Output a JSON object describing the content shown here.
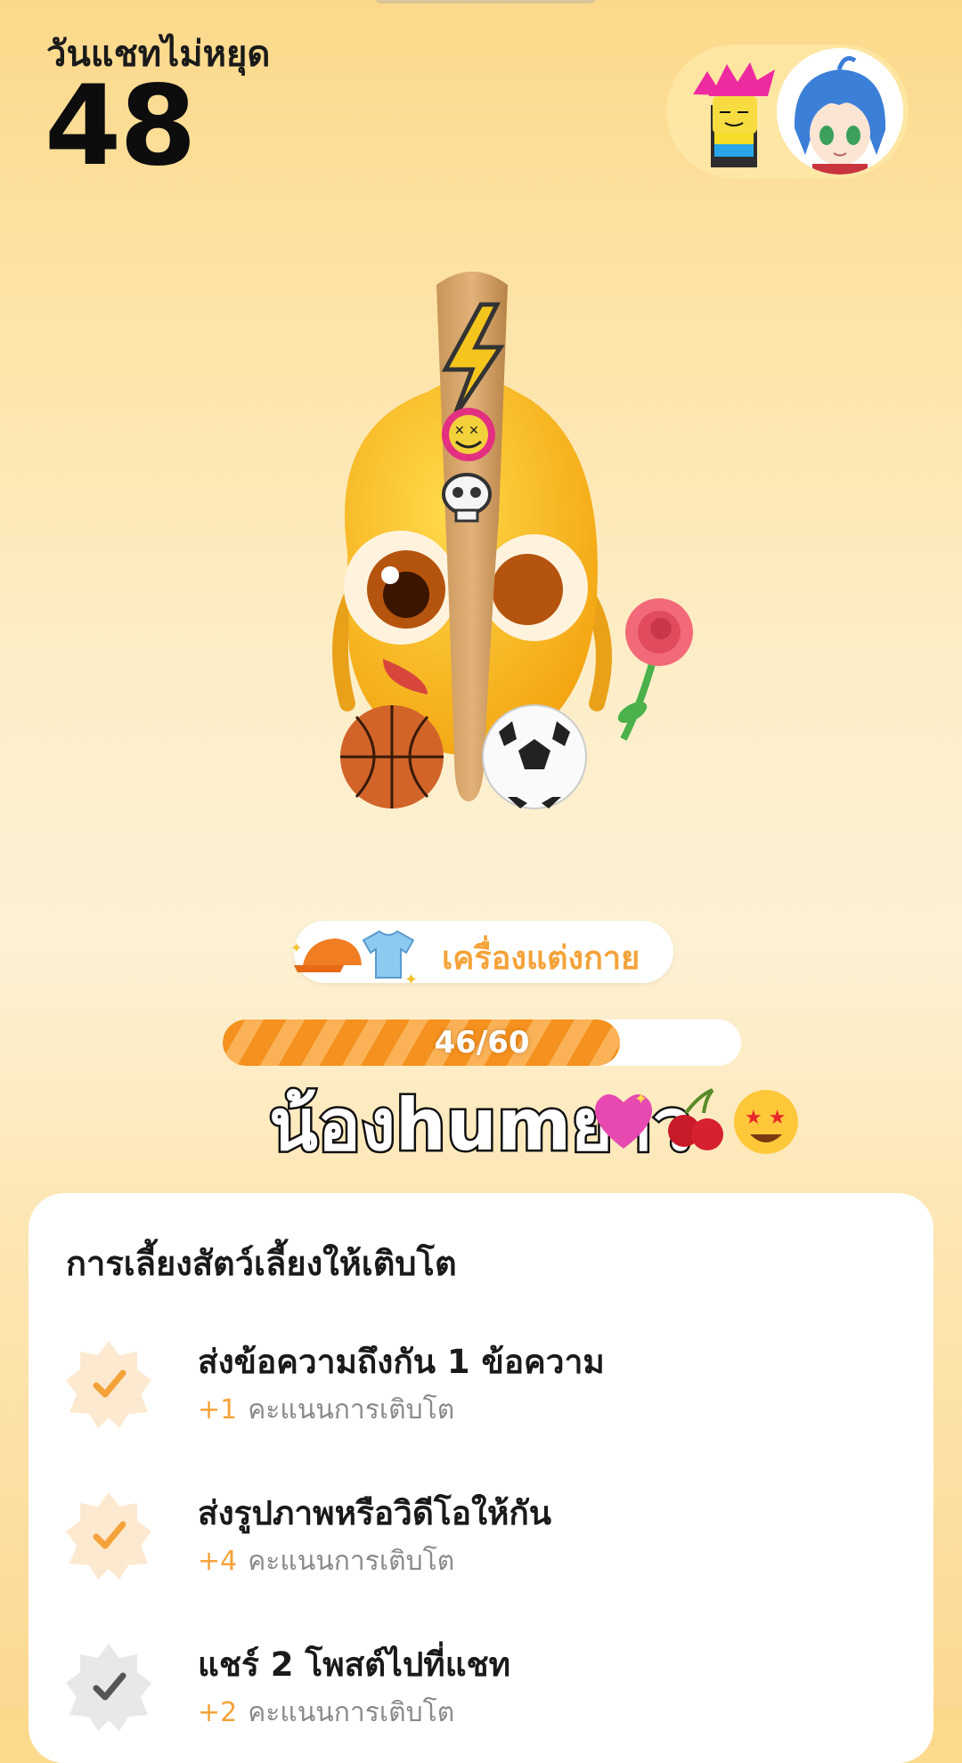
{
  "streak": {
    "label": "วันแชทไม่หยุด",
    "count": "48"
  },
  "accessory": {
    "label": "เครื่องแต่งกาย"
  },
  "growth": {
    "text": "46/60",
    "current": 46,
    "total": 60
  },
  "pet": {
    "name": "น้องhumยาว"
  },
  "card": {
    "title": "การเลี้ยงสัตว์เลี้ยงให้เติบโต",
    "tasks": [
      {
        "title": "ส่งข้อความถึงกัน 1 ข้อความ",
        "plus": "+1",
        "points_label": "คะแนนการเติบโต",
        "done": true
      },
      {
        "title": "ส่งรูปภาพหรือวิดีโอให้กัน",
        "plus": "+4",
        "points_label": "คะแนนการเติบโต",
        "done": true
      },
      {
        "title": "แชร์ 2 โพสต์ไปที่แชท",
        "plus": "+2",
        "points_label": "คะแนนการเติบโต",
        "done": false
      }
    ]
  },
  "colors": {
    "accent": "#f4a33a",
    "progress": "#f5911e",
    "badge_done": "#fde9cf",
    "badge_todo": "#e8e8e8"
  }
}
